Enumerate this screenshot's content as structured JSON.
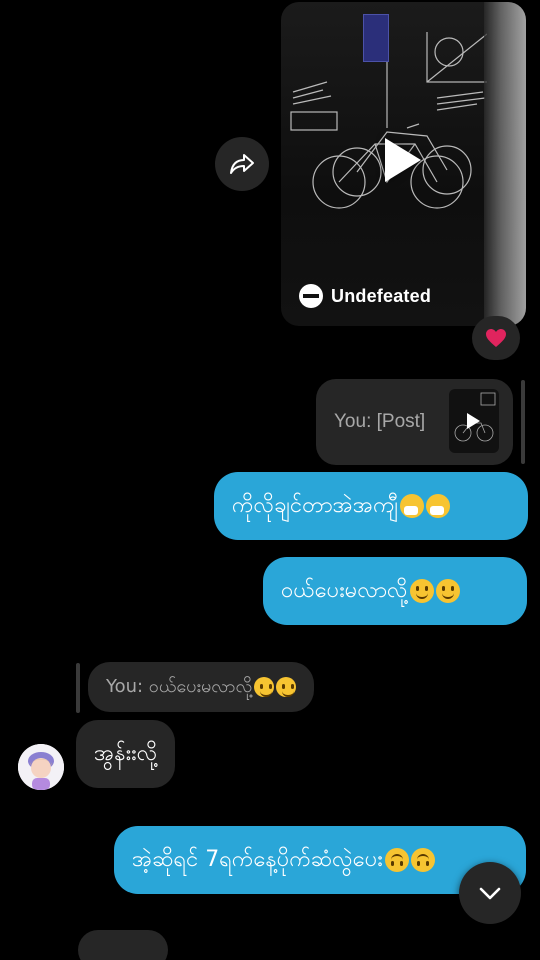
{
  "post": {
    "author": "Undefeated"
  },
  "reaction": {
    "emoji": "heart-icon",
    "color": "#e0245e"
  },
  "reply_own": {
    "text": "You: [Post]"
  },
  "messages_out": [
    {
      "text": "ကိုလိုချင်တာအဲအကျီ",
      "emojis": [
        "sneezing-face",
        "sneezing-face"
      ]
    },
    {
      "text": "ဝယ်ပေးမလာလို့",
      "emojis": [
        "slightly-smiling-face",
        "slightly-smiling-face"
      ]
    }
  ],
  "reply_in": {
    "text": "You: ဝယ်ပေးမလာလို့",
    "emojis": [
      "slightly-smiling-face",
      "slightly-smiling-face"
    ]
  },
  "message_in": {
    "text": "အွန်းးလို့"
  },
  "message_out_last": {
    "text": "အဲ့ဆိုရင် 7ရက်နေ့ပိုက်ဆံလွဲပေး",
    "emojis": [
      "upside-down-face",
      "upside-down-face"
    ]
  },
  "colors": {
    "outgoing_bubble": "#2aa6d8",
    "incoming_bubble": "#262626",
    "background": "#000000"
  }
}
